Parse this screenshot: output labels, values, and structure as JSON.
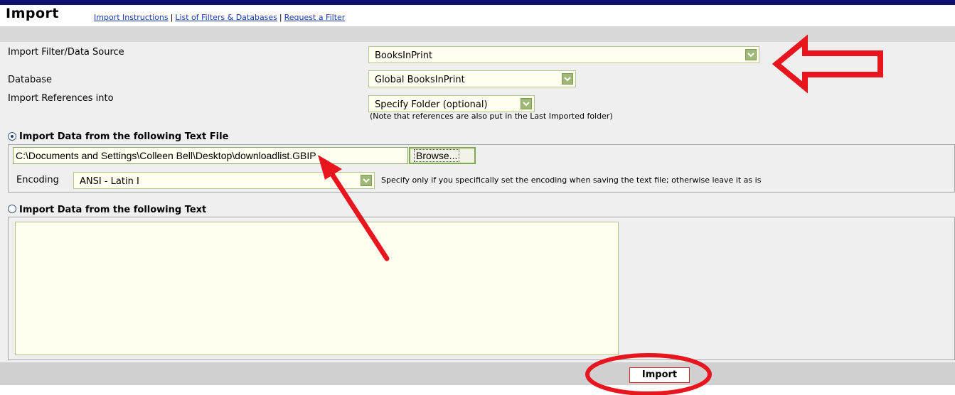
{
  "page": {
    "title": "Import",
    "links": [
      "Import Instructions",
      "List of Filters & Databases",
      "Request a Filter"
    ],
    "link_separator": "|"
  },
  "form": {
    "filter": {
      "label": "Import Filter/Data Source",
      "value": "BooksInPrint"
    },
    "database": {
      "label": "Database",
      "value": "Global BooksInPrint"
    },
    "folder": {
      "label": "Import References into",
      "value": "Specify Folder (optional)",
      "note": "(Note that references are also put in the Last Imported folder)"
    }
  },
  "file_section": {
    "label": "Import Data from the following Text File",
    "selected": true,
    "file_path": "C:\\Documents and Settings\\Colleen Bell\\Desktop\\downloadlist.GBIP",
    "browse_label": "Browse...",
    "encoding_label": "Encoding",
    "encoding_value": "ANSI - Latin I",
    "encoding_hint": "Specify only if you specifically set the encoding when saving the text file; otherwise leave it as is"
  },
  "text_section": {
    "label": "Import Data from the following Text",
    "selected": false,
    "text_value": ""
  },
  "footer": {
    "import_label": "Import"
  },
  "colors": {
    "top_bar": "#10106e",
    "link": "#1a3aa8",
    "annotation": "#e8141e",
    "select_bg": "#fffff0",
    "arrow_button": "#9fb878"
  },
  "icons": {
    "select_arrow": "chevron-down-icon",
    "annotation_arrow_left": "hollow-left-arrow-icon",
    "annotation_arrow_up": "pointer-arrow-icon",
    "annotation_circle": "highlight-ellipse-icon"
  }
}
